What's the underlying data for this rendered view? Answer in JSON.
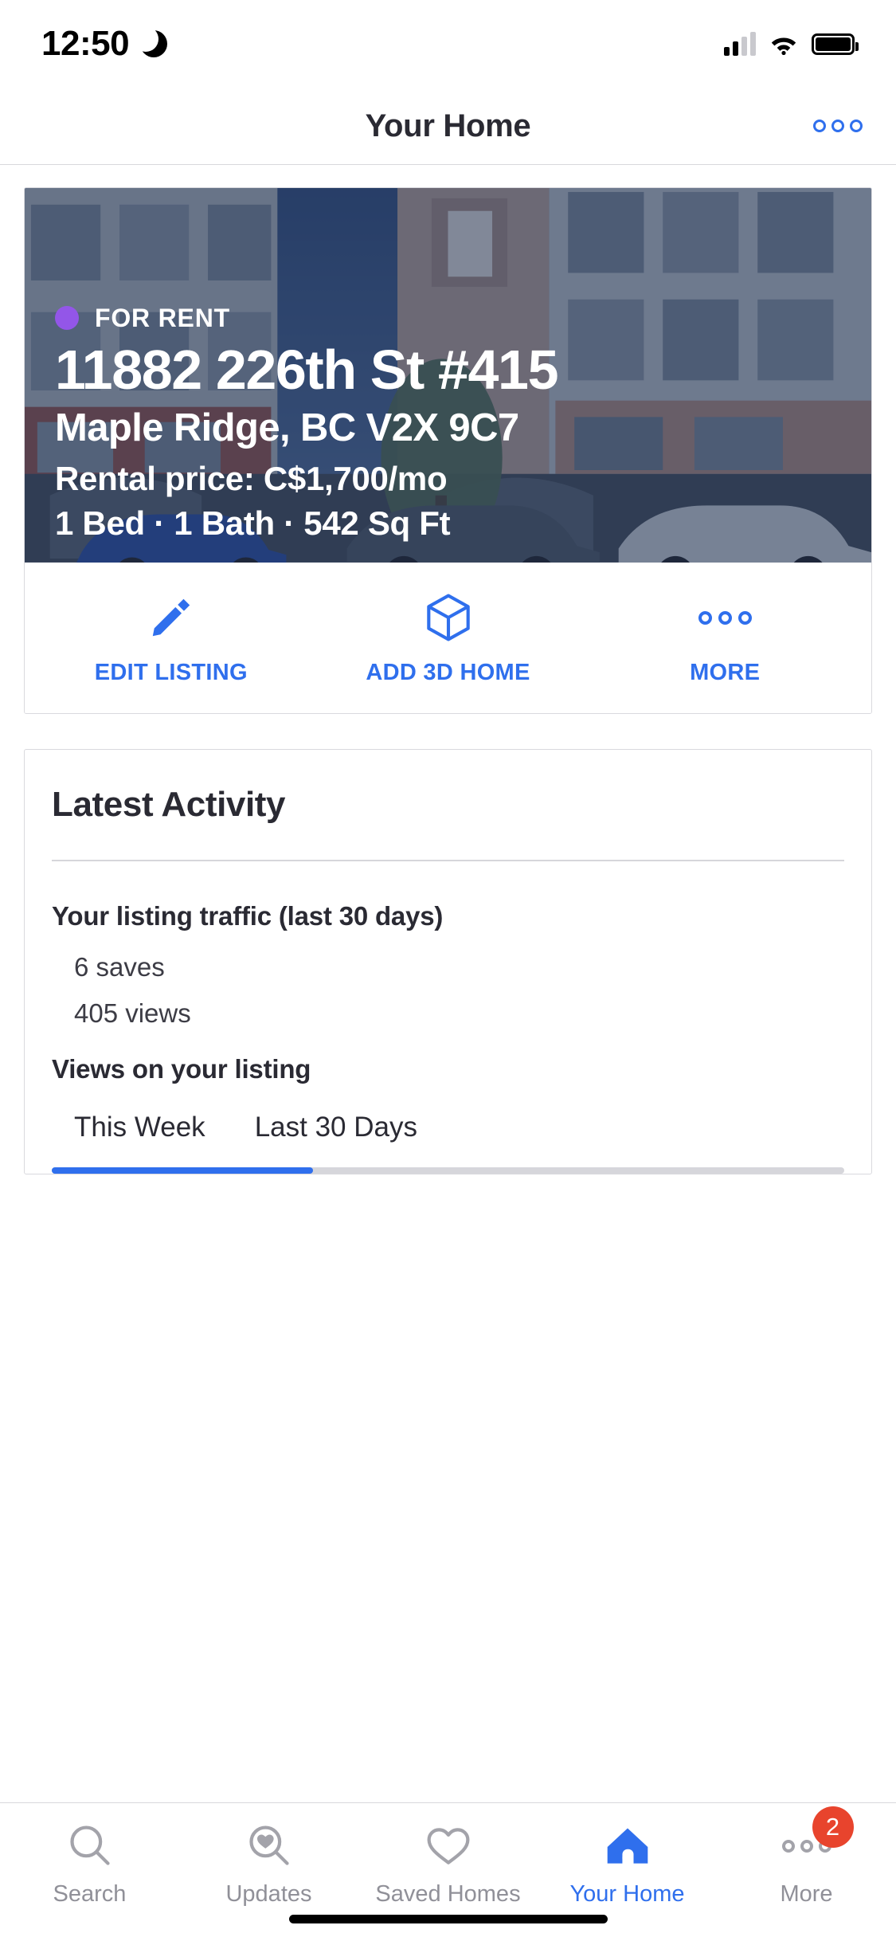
{
  "status_bar": {
    "time": "12:50",
    "dnd_icon": "crescent-moon-icon",
    "signal_icon": "cellular-signal-icon",
    "wifi_icon": "wifi-icon",
    "battery_icon": "battery-full-icon"
  },
  "header": {
    "title": "Your Home",
    "more_icon": "ellipsis-icon"
  },
  "listing": {
    "status_label": "FOR RENT",
    "status_dot_color": "#9356e8",
    "address": "11882 226th St #415",
    "city_state_zip": "Maple Ridge, BC V2X 9C7",
    "price": "Rental price: C$1,700/mo",
    "facts": "1 Bed · 1 Bath · 542 Sq Ft",
    "overlay_color": "#263656"
  },
  "actions": [
    {
      "label": "EDIT LISTING",
      "icon": "pencil-icon"
    },
    {
      "label": "ADD 3D HOME",
      "icon": "cube-3d-icon"
    },
    {
      "label": "MORE",
      "icon": "ellipsis-icon"
    }
  ],
  "activity": {
    "title": "Latest Activity",
    "traffic_title": "Your listing traffic (last 30 days)",
    "saves": "6 saves",
    "views": "405 views",
    "views_title": "Views on your listing",
    "tabs": [
      {
        "label": "This Week",
        "active": true
      },
      {
        "label": "Last 30 Days",
        "active": false
      }
    ]
  },
  "tabbar": [
    {
      "label": "Search",
      "icon": "search-icon",
      "active": false
    },
    {
      "label": "Updates",
      "icon": "search-heart-icon",
      "active": false
    },
    {
      "label": "Saved Homes",
      "icon": "heart-icon",
      "active": false
    },
    {
      "label": "Your Home",
      "icon": "house-icon",
      "active": true
    },
    {
      "label": "More",
      "icon": "ellipsis-icon",
      "active": false,
      "badge": "2"
    }
  ],
  "colors": {
    "accent_blue": "#2f6fed",
    "badge_red": "#e8442d",
    "muted_gray": "#909098"
  }
}
